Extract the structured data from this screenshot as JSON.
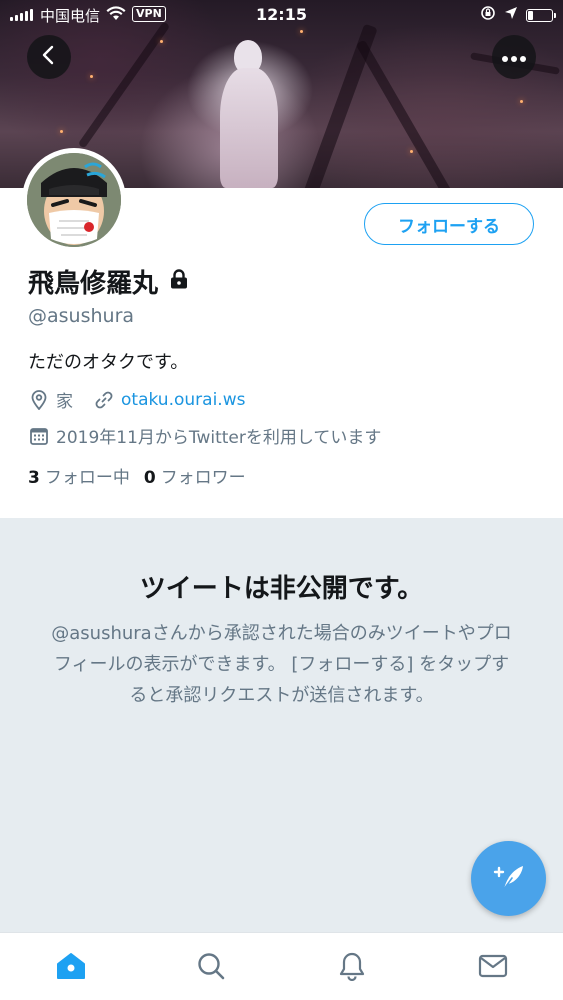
{
  "status_bar": {
    "carrier": "中国电信",
    "vpn": "VPN",
    "time": "12:15"
  },
  "profile": {
    "display_name": "飛鳥修羅丸",
    "username": "@asushura",
    "bio": "ただのオタクです。",
    "location": "家",
    "website": "otaku.ourai.ws",
    "joined": "2019年11月からTwitterを利用しています",
    "following_count": "3",
    "following_label": "フォロー中",
    "followers_count": "0",
    "followers_label": "フォロワー",
    "follow_button": "フォローする",
    "protected": true
  },
  "private_notice": {
    "title": "ツイートは非公開です。",
    "description": "@asushuraさんから承認された場合のみツイートやプロフィールの表示ができます。 [フォローする] をタップすると承認リクエストが送信されます。"
  },
  "colors": {
    "accent": "#1da1f2",
    "fab": "#4aa3ea",
    "private_bg": "#e6ecf0",
    "secondary_text": "#657786"
  },
  "icons": {
    "back": "chevron-left-icon",
    "more": "more-icon",
    "lock": "lock-icon",
    "location": "location-pin-icon",
    "link": "link-icon",
    "calendar": "calendar-icon",
    "compose": "compose-tweet-icon",
    "tabs": [
      "home-icon",
      "search-icon",
      "notifications-icon",
      "messages-icon"
    ]
  }
}
